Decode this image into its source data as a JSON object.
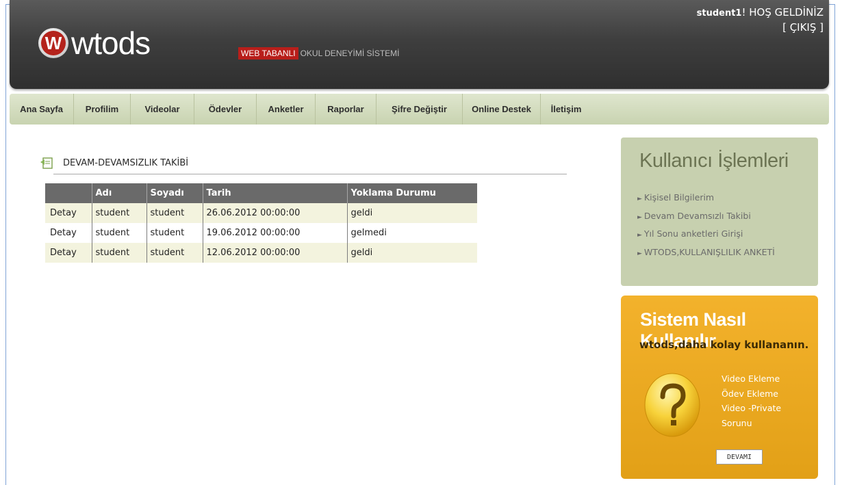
{
  "header": {
    "logo_text": "wtods",
    "logo_mark": "W",
    "tag_highlight": "WEB TABANLI",
    "tag_rest": "OKUL DENEYİMİ SİSTEMİ",
    "welcome_user": "student1",
    "welcome_text": "! HOŞ GELDİNİZ",
    "logout": "[ ÇIKIŞ ]"
  },
  "nav": {
    "items": [
      {
        "label": "Ana Sayfa"
      },
      {
        "label": "Profilim"
      },
      {
        "label": "Videolar"
      },
      {
        "label": "Ödevler"
      },
      {
        "label": "Anketler"
      },
      {
        "label": "Raporlar"
      },
      {
        "label": "Şifre Değiştir"
      },
      {
        "label": "Online Destek"
      },
      {
        "label": "İletişim"
      }
    ]
  },
  "main": {
    "section_title": "DEVAM-DEVAMSIZLIK TAKİBİ",
    "table": {
      "headers": [
        "",
        "Adı",
        "Soyadı",
        "Tarih",
        "Yoklama Durumu"
      ],
      "rows": [
        [
          "Detay",
          "student",
          "student",
          "26.06.2012 00:00:00",
          "geldi"
        ],
        [
          "Detay",
          "student",
          "student",
          "19.06.2012 00:00:00",
          "gelmedi"
        ],
        [
          "Detay",
          "student",
          "student",
          "12.06.2012 00:00:00",
          "geldi"
        ]
      ]
    }
  },
  "sidebar": {
    "user_panel": {
      "title": "Kullanıcı İşlemleri",
      "links": [
        "Kişisel Bilgilerim",
        "Devam Devamsızlı Takibi",
        "Yıl Sonu anketleri Girişi",
        "WTODS,KULLANIŞLILIK ANKETİ"
      ]
    },
    "help_panel": {
      "title": "Sistem Nasıl Kullanılır",
      "subtitle": "wtods,daha kolay kullananın.",
      "links": [
        "Video Ekleme",
        "Ödev Ekleme",
        "Video -Private",
        "Sorunu"
      ],
      "button": "DEVAMI"
    }
  },
  "colors": {
    "header_bg": "#3e3e3e",
    "nav_bg": "#d4dcbf",
    "table_header": "#6a6a6a",
    "row_alt": "#f3f3de",
    "tag_red": "#b81e1a",
    "user_panel": "#c7d0af",
    "help_panel": "#f0ad26"
  },
  "icons": {
    "section": "document-icon",
    "help": "question-mark-icon",
    "list_bullet": "triangle-bullet-icon"
  }
}
